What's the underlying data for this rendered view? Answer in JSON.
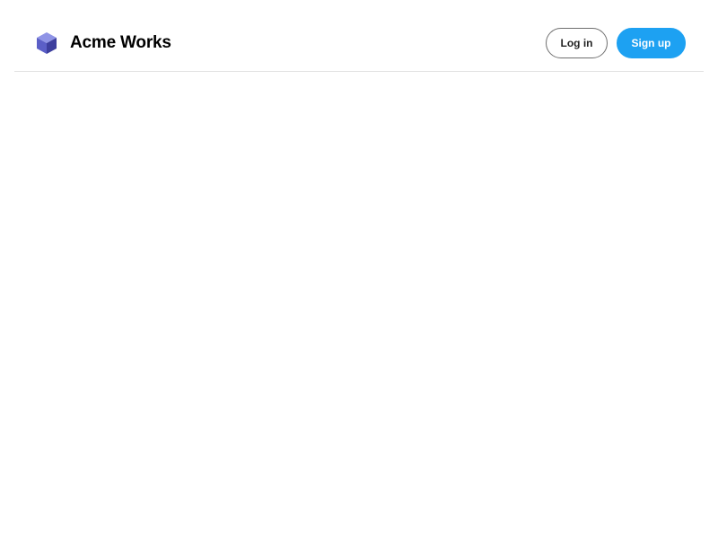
{
  "header": {
    "brand_name": "Acme Works",
    "login_label": "Log in",
    "signup_label": "Sign up"
  },
  "colors": {
    "accent": "#1da1f2",
    "logo_primary": "#5b5fc7",
    "logo_light": "#8f94e6",
    "logo_dark": "#3d3f9e"
  },
  "icons": {
    "logo": "cube-icon"
  }
}
